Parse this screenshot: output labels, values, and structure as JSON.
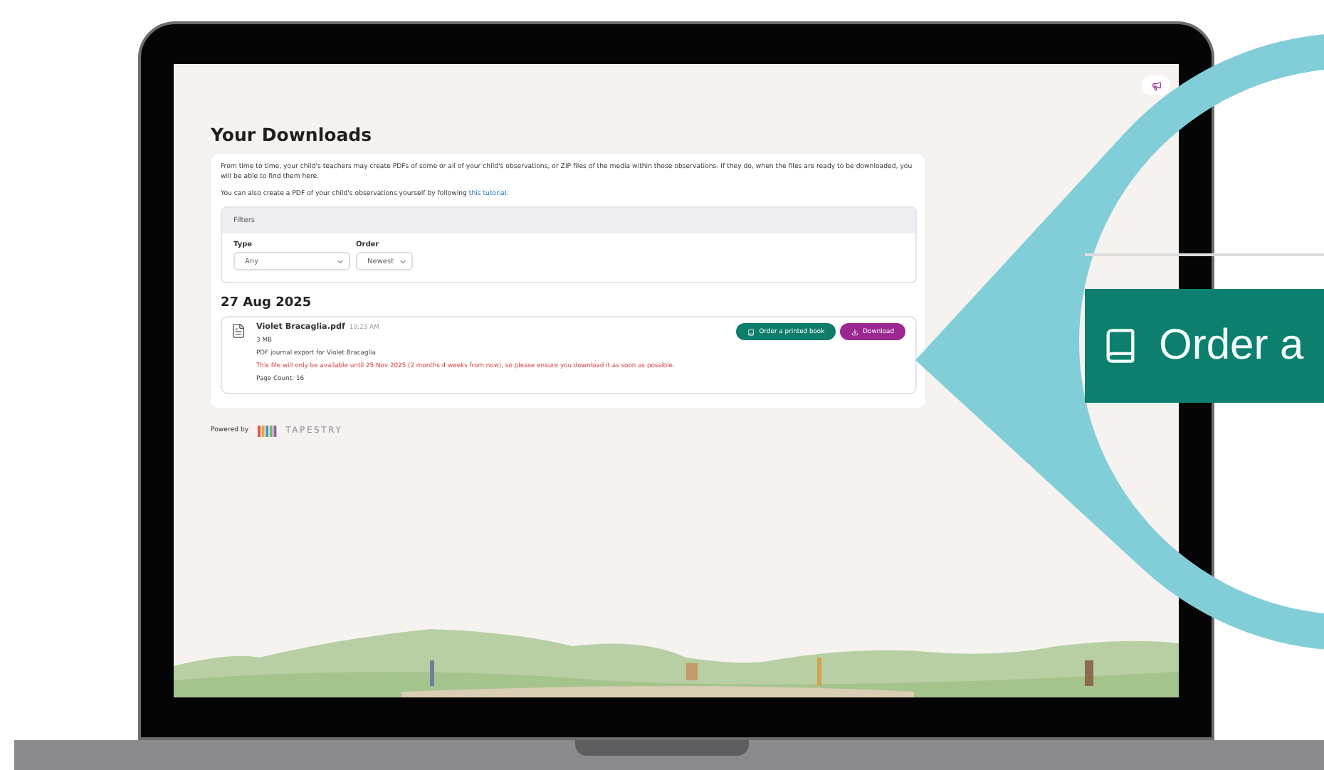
{
  "page": {
    "title": "Your Downloads",
    "intro": "From time to time, your child's teachers may create PDFs of some or all of your child's observations, or ZIP files of the media within those observations. If they do, when the files are ready to be downloaded, you will be able to find them here.",
    "tutorial_prefix": "You can also create a PDF of your child's observations yourself by following ",
    "tutorial_link": "this tutorial",
    "tutorial_suffix": "."
  },
  "filters": {
    "title": "Filters",
    "fields": [
      {
        "label": "Type",
        "value": "Any"
      },
      {
        "label": "Order",
        "value": "Newest"
      }
    ]
  },
  "groups": [
    {
      "date": "27 Aug 2025",
      "files": [
        {
          "name": "Violet Bracaglia.pdf",
          "time": "10:23 AM",
          "size": "3 MB",
          "description": "PDF journal export for Violet Bracaglia",
          "warning": "This file will only be available until 25 Nov 2025 (2 months 4 weeks from now), so please ensure you download it as soon as possible.",
          "page_count": "Page Count: 16",
          "buttons": [
            {
              "kind": "order",
              "label": "Order a printed book"
            },
            {
              "kind": "download",
              "label": "Download"
            }
          ]
        }
      ]
    }
  ],
  "footer": {
    "powered_by": "Powered by",
    "brand": "TAPESTRY"
  },
  "callout": {
    "label": "Order a"
  }
}
